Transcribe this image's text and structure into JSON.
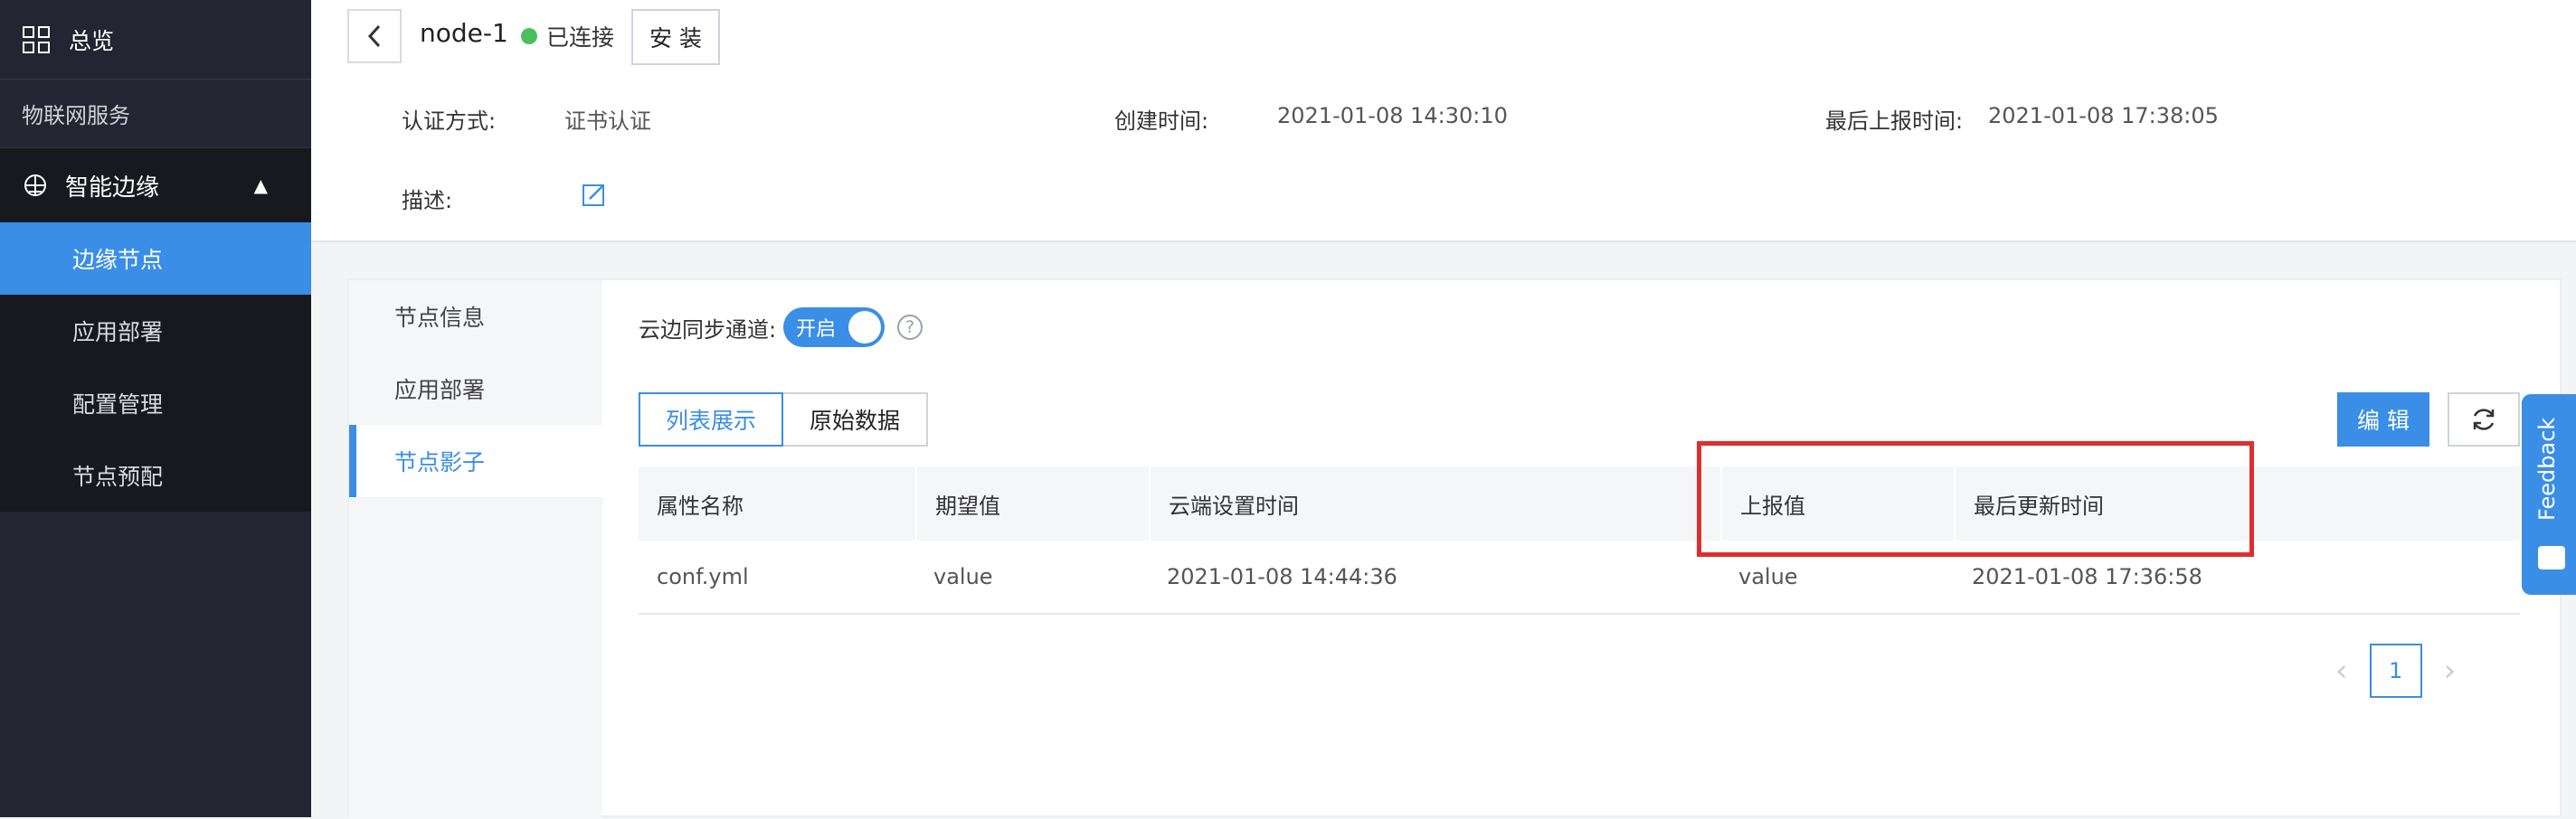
{
  "sidebar": {
    "overview": "总览",
    "section": "物联网服务",
    "group": "智能边缘",
    "items": [
      {
        "label": "边缘节点",
        "active": true
      },
      {
        "label": "应用部署",
        "active": false
      },
      {
        "label": "配置管理",
        "active": false
      },
      {
        "label": "节点预配",
        "active": false
      }
    ]
  },
  "header": {
    "node_name": "node-1",
    "status": "已连接",
    "install_label": "安 装",
    "auth_label": "认证方式:",
    "auth_value": "证书认证",
    "created_label": "创建时间:",
    "created_value": "2021-01-08 14:30:10",
    "reported_label": "最后上报时间:",
    "reported_value": "2021-01-08 17:38:05",
    "desc_label": "描述:"
  },
  "tabs": [
    {
      "label": "节点信息",
      "active": false
    },
    {
      "label": "应用部署",
      "active": false
    },
    {
      "label": "节点影子",
      "active": true
    }
  ],
  "shadow": {
    "sync_label": "云边同步通道:",
    "toggle_label": "开启",
    "help": "?",
    "view_list": "列表展示",
    "view_raw": "原始数据",
    "edit_label": "编 辑",
    "columns": [
      "属性名称",
      "期望值",
      "云端设置时间",
      "上报值",
      "最后更新时间"
    ],
    "rows": [
      [
        "conf.yml",
        "value",
        "2021-01-08 14:44:36",
        "value",
        "2021-01-08 17:36:58"
      ]
    ],
    "page": "1"
  },
  "feedback_label": "Feedback",
  "colors": {
    "accent": "#3a8ee6",
    "sidebar_bg": "#232632",
    "connected": "#4cbf5c",
    "highlight": "#dd2f2f"
  }
}
